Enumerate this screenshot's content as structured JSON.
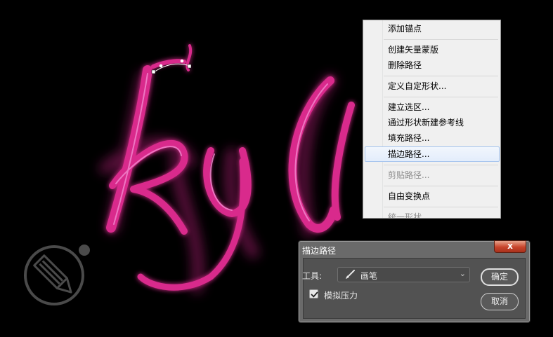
{
  "context_menu": {
    "items": [
      {
        "label": "添加锚点",
        "enabled": true
      },
      {
        "label": "创建矢量蒙版",
        "enabled": true
      },
      {
        "label": "删除路径",
        "enabled": true
      },
      {
        "label": "定义自定形状...",
        "enabled": true
      },
      {
        "label": "建立选区...",
        "enabled": true
      },
      {
        "label": "通过形状新建参考线",
        "enabled": true
      },
      {
        "label": "填充路径...",
        "enabled": true
      },
      {
        "label": "描边路径...",
        "enabled": true,
        "highlighted": true
      },
      {
        "label": "剪贴路径...",
        "enabled": false
      },
      {
        "label": "自由变换点",
        "enabled": true
      },
      {
        "label": "统一形状",
        "enabled": false
      }
    ]
  },
  "dialog": {
    "title": "描边路径",
    "close_label": "x",
    "tool_label": "工具:",
    "tool_value": "画笔",
    "simulate_pressure_label": "模拟压力",
    "simulate_pressure_checked": true,
    "ok_label": "确定",
    "cancel_label": "取消"
  },
  "colors": {
    "text_glow": "#e0308f",
    "menu_bg": "#f0f0f0",
    "menu_highlight": "#a8c6ee",
    "dialog_bg": "#525252",
    "close_button": "#c7432a"
  },
  "icons": [
    "pencil-logo-icon",
    "brush-icon",
    "chevron-down-icon",
    "checkmark-icon"
  ]
}
